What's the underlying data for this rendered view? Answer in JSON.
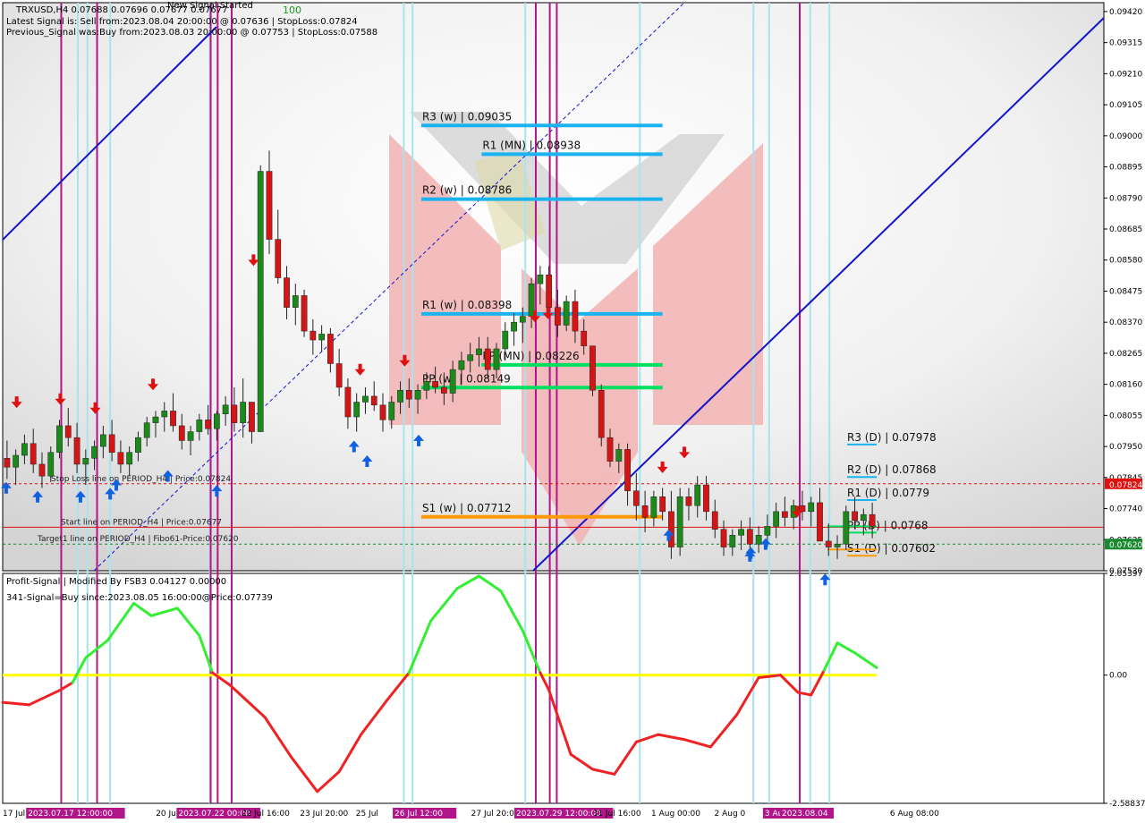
{
  "header": {
    "symbol_line": "TRXUSD,H4  0.07688 0.07696 0.07677 0.07677",
    "latest_signal": "Latest Signal is: Sell from:2023.08.04 20:00:00 @ 0.07636 | StopLoss:0.07824",
    "previous_signal": "Previous_Signal was:Buy from:2023.08.03 20:00:00 @ 0.07753 | StopLoss:0.07588",
    "new_signal": "New Signal Started",
    "signal_value": "100"
  },
  "colors": {
    "bull_candle": "#1b8a1b",
    "bear_candle": "#d31515",
    "pivot_blue": "#1ab3f0",
    "pivot_green": "#00e060",
    "pivot_orange": "#ff9900",
    "magenta_line": "#b0158a",
    "cyan_line": "#a8e4ee",
    "channel_blue": "#1414cc",
    "osc_green": "#33ee33",
    "osc_red": "#ee2222",
    "zero_line": "#ffff00",
    "stoploss_label_bg": "#e01010",
    "target_label_bg": "#1a8a30"
  },
  "price_axis": {
    "labels": [
      "0.09420",
      "0.09315",
      "0.09210",
      "0.09105",
      "0.09000",
      "0.08895",
      "0.08790",
      "0.08685",
      "0.08580",
      "0.08475",
      "0.08370",
      "0.08265",
      "0.08160",
      "0.08055",
      "0.07950",
      "0.07845",
      "0.07740",
      "0.07635",
      "0.07530"
    ],
    "stoploss_tag": "0.07824",
    "target_tag": "0.07620"
  },
  "osc_axis": {
    "labels": [
      "2.05397",
      "0.00",
      "-2.58837"
    ]
  },
  "time_axis": {
    "labels": [
      "17 Jul 2023",
      "2023.07.17 12:00:00",
      "20 Jul 2023 00:00",
      "2023.07.22 00:00",
      "22 Jul 16:00",
      "23 Jul 20:00",
      "25 Jul",
      "26 Jul 12:00",
      "27 Jul 20:00",
      "2023.07.29 12:00:00",
      "31 Jul 16:00",
      "1 Aug 00:00",
      "2 Aug 0",
      "3 Aug 2023",
      "2023.08.04",
      "6 Aug 08:00"
    ]
  },
  "pivots": [
    {
      "label": "R3 (w) | 0.09035",
      "price": 0.09035,
      "color": "#1ab3f0",
      "from": 0.479,
      "to": 0.755
    },
    {
      "label": "R1 (MN) | 0.08938",
      "price": 0.08938,
      "color": "#1ab3f0",
      "from": 0.548,
      "to": 0.755
    },
    {
      "label": "R2 (w) | 0.08786",
      "price": 0.08786,
      "color": "#1ab3f0",
      "from": 0.479,
      "to": 0.755
    },
    {
      "label": "R1 (w) | 0.08398",
      "price": 0.08398,
      "color": "#1ab3f0",
      "from": 0.479,
      "to": 0.755
    },
    {
      "label": "PP (MN) | 0.08226",
      "price": 0.08226,
      "color": "#00e060",
      "from": 0.548,
      "to": 0.755
    },
    {
      "label": "PP (w) | 0.08149",
      "price": 0.08149,
      "color": "#00e060",
      "from": 0.479,
      "to": 0.755
    },
    {
      "label": "S1 (w) | 0.07712",
      "price": 0.07712,
      "color": "#ff9900",
      "from": 0.479,
      "to": 0.755
    }
  ],
  "daily_pivots": [
    {
      "label": "R3 (D)",
      "value": "0.07978",
      "price": 0.07978,
      "color": "#1ab3f0"
    },
    {
      "label": "R2 (D)",
      "value": "0.07868",
      "price": 0.07868,
      "color": "#1ab3f0"
    },
    {
      "label": "R1 (D)",
      "value": "0.0779",
      "price": 0.0779,
      "color": "#1ab3f0"
    },
    {
      "label": "PP (D)",
      "value": "0.0768",
      "price": 0.0768,
      "color": "#00e060"
    },
    {
      "label": "S1 (D)",
      "value": "0.07602",
      "price": 0.07602,
      "color": "#ff9900"
    }
  ],
  "hlines": [
    {
      "label": "Stop Loss line on PERIOD_H4 | Price:0.07824",
      "price": 0.07824,
      "color": "#e01010",
      "dash": true
    },
    {
      "label": "Start line on PERIOD_H4 | Price:0.07677",
      "price": 0.07677,
      "color": "#e01010",
      "dash": false
    },
    {
      "label": "Target1 line on PERIOD_H4 | Fibo61-Price:0.07620",
      "price": 0.0762,
      "color": "#1a8a30",
      "dash": true
    }
  ],
  "osc": {
    "title": "Profit-Signal | Modified By FSB3 0.04127 0.00000",
    "signal_text": "341-Signal=Buy since:2023.08.05 16:00:00@Price:0.07739"
  },
  "chart_data": {
    "type": "candlestick",
    "title": "TRXUSD,H4",
    "ylim": [
      0.0753,
      0.0945
    ],
    "candles": [
      [
        0.0791,
        0.0797,
        0.0784,
        0.0788
      ],
      [
        0.0788,
        0.0794,
        0.0782,
        0.0792
      ],
      [
        0.0792,
        0.0799,
        0.0789,
        0.0796
      ],
      [
        0.0796,
        0.0801,
        0.0786,
        0.0789
      ],
      [
        0.0789,
        0.0793,
        0.0781,
        0.0785
      ],
      [
        0.0785,
        0.0795,
        0.0783,
        0.0793
      ],
      [
        0.0793,
        0.0804,
        0.0791,
        0.0802
      ],
      [
        0.0802,
        0.0808,
        0.0795,
        0.0798
      ],
      [
        0.0798,
        0.0803,
        0.0786,
        0.0789
      ],
      [
        0.0789,
        0.0794,
        0.0782,
        0.0791
      ],
      [
        0.0791,
        0.0797,
        0.0787,
        0.0795
      ],
      [
        0.0795,
        0.0802,
        0.0791,
        0.0799
      ],
      [
        0.0799,
        0.0804,
        0.079,
        0.0793
      ],
      [
        0.0793,
        0.0797,
        0.0786,
        0.0789
      ],
      [
        0.0789,
        0.0795,
        0.0785,
        0.0793
      ],
      [
        0.0793,
        0.08,
        0.079,
        0.0798
      ],
      [
        0.0798,
        0.0805,
        0.0795,
        0.0803
      ],
      [
        0.0803,
        0.0807,
        0.0798,
        0.0805
      ],
      [
        0.0805,
        0.081,
        0.08,
        0.0807
      ],
      [
        0.0807,
        0.0813,
        0.08,
        0.0802
      ],
      [
        0.0802,
        0.0806,
        0.0794,
        0.0797
      ],
      [
        0.0797,
        0.0802,
        0.0792,
        0.08
      ],
      [
        0.08,
        0.0806,
        0.0797,
        0.0804
      ],
      [
        0.0804,
        0.0809,
        0.0799,
        0.0801
      ],
      [
        0.0801,
        0.0807,
        0.0797,
        0.0806
      ],
      [
        0.0806,
        0.0812,
        0.0802,
        0.0809
      ],
      [
        0.0809,
        0.0815,
        0.08,
        0.0803
      ],
      [
        0.0803,
        0.0818,
        0.0798,
        0.081
      ],
      [
        0.081,
        0.081,
        0.0796,
        0.08
      ],
      [
        0.08,
        0.089,
        0.08,
        0.0888
      ],
      [
        0.0888,
        0.0895,
        0.086,
        0.0865
      ],
      [
        0.0865,
        0.0875,
        0.085,
        0.0852
      ],
      [
        0.0852,
        0.0856,
        0.0838,
        0.0842
      ],
      [
        0.0842,
        0.085,
        0.0836,
        0.0846
      ],
      [
        0.0846,
        0.0848,
        0.0832,
        0.0834
      ],
      [
        0.0834,
        0.0838,
        0.0826,
        0.0831
      ],
      [
        0.0831,
        0.0836,
        0.0827,
        0.0833
      ],
      [
        0.0833,
        0.0835,
        0.082,
        0.0823
      ],
      [
        0.0823,
        0.0828,
        0.0812,
        0.0815
      ],
      [
        0.0815,
        0.0818,
        0.0801,
        0.0805
      ],
      [
        0.0805,
        0.0813,
        0.08,
        0.081
      ],
      [
        0.081,
        0.0815,
        0.0806,
        0.0812
      ],
      [
        0.0812,
        0.0817,
        0.0807,
        0.0809
      ],
      [
        0.0809,
        0.0813,
        0.08,
        0.0804
      ],
      [
        0.0804,
        0.0812,
        0.0801,
        0.081
      ],
      [
        0.081,
        0.0817,
        0.0806,
        0.0814
      ],
      [
        0.0814,
        0.0818,
        0.0808,
        0.0811
      ],
      [
        0.0811,
        0.0816,
        0.0806,
        0.0814
      ],
      [
        0.0814,
        0.082,
        0.0811,
        0.0817
      ],
      [
        0.0817,
        0.0822,
        0.0813,
        0.0815
      ],
      [
        0.0815,
        0.082,
        0.0809,
        0.0813
      ],
      [
        0.0813,
        0.0824,
        0.081,
        0.0821
      ],
      [
        0.0821,
        0.0827,
        0.0816,
        0.0824
      ],
      [
        0.0824,
        0.083,
        0.082,
        0.0826
      ],
      [
        0.0826,
        0.0832,
        0.0822,
        0.0828
      ],
      [
        0.0828,
        0.0832,
        0.0818,
        0.0821
      ],
      [
        0.0821,
        0.083,
        0.0818,
        0.0828
      ],
      [
        0.0828,
        0.0837,
        0.0824,
        0.0834
      ],
      [
        0.0834,
        0.084,
        0.0829,
        0.0837
      ],
      [
        0.0837,
        0.0842,
        0.083,
        0.0839
      ],
      [
        0.0839,
        0.0852,
        0.0835,
        0.085
      ],
      [
        0.085,
        0.0856,
        0.0843,
        0.0853
      ],
      [
        0.0853,
        0.0856,
        0.0839,
        0.0842
      ],
      [
        0.0842,
        0.0848,
        0.0832,
        0.0836
      ],
      [
        0.0836,
        0.0846,
        0.0834,
        0.0844
      ],
      [
        0.0844,
        0.0848,
        0.083,
        0.0834
      ],
      [
        0.0834,
        0.0838,
        0.0826,
        0.0829
      ],
      [
        0.0829,
        0.0829,
        0.0812,
        0.0814
      ],
      [
        0.0814,
        0.0816,
        0.0795,
        0.0798
      ],
      [
        0.0798,
        0.0801,
        0.0788,
        0.079
      ],
      [
        0.079,
        0.0796,
        0.0786,
        0.0794
      ],
      [
        0.0794,
        0.0796,
        0.0775,
        0.078
      ],
      [
        0.078,
        0.0786,
        0.077,
        0.0775
      ],
      [
        0.0775,
        0.078,
        0.0766,
        0.0771
      ],
      [
        0.0771,
        0.078,
        0.0768,
        0.0778
      ],
      [
        0.0778,
        0.0781,
        0.077,
        0.0773
      ],
      [
        0.0773,
        0.078,
        0.0757,
        0.0761
      ],
      [
        0.0761,
        0.0781,
        0.0758,
        0.0778
      ],
      [
        0.0778,
        0.0781,
        0.077,
        0.0775
      ],
      [
        0.0775,
        0.0785,
        0.0771,
        0.0782
      ],
      [
        0.0782,
        0.0785,
        0.077,
        0.0773
      ],
      [
        0.0773,
        0.0777,
        0.0764,
        0.0767
      ],
      [
        0.0767,
        0.077,
        0.0758,
        0.0761
      ],
      [
        0.0761,
        0.0767,
        0.0758,
        0.0765
      ],
      [
        0.0765,
        0.077,
        0.076,
        0.0767
      ],
      [
        0.0767,
        0.0771,
        0.076,
        0.0762
      ],
      [
        0.0762,
        0.0768,
        0.0759,
        0.0765
      ],
      [
        0.0765,
        0.0772,
        0.0761,
        0.0768
      ],
      [
        0.0768,
        0.0776,
        0.0764,
        0.0773
      ],
      [
        0.0773,
        0.0778,
        0.0768,
        0.0771
      ],
      [
        0.0771,
        0.0777,
        0.0767,
        0.0775
      ],
      [
        0.0775,
        0.078,
        0.077,
        0.0773
      ],
      [
        0.0773,
        0.0778,
        0.0768,
        0.0776
      ],
      [
        0.0776,
        0.0781,
        0.0771,
        0.0763
      ],
      [
        0.0763,
        0.0769,
        0.0758,
        0.0761
      ],
      [
        0.0761,
        0.0765,
        0.0757,
        0.0762
      ],
      [
        0.0762,
        0.0775,
        0.076,
        0.0773
      ],
      [
        0.0773,
        0.0778,
        0.0767,
        0.077
      ],
      [
        0.077,
        0.0774,
        0.0765,
        0.0772
      ],
      [
        0.0772,
        0.0776,
        0.0764,
        0.0768
      ]
    ]
  }
}
